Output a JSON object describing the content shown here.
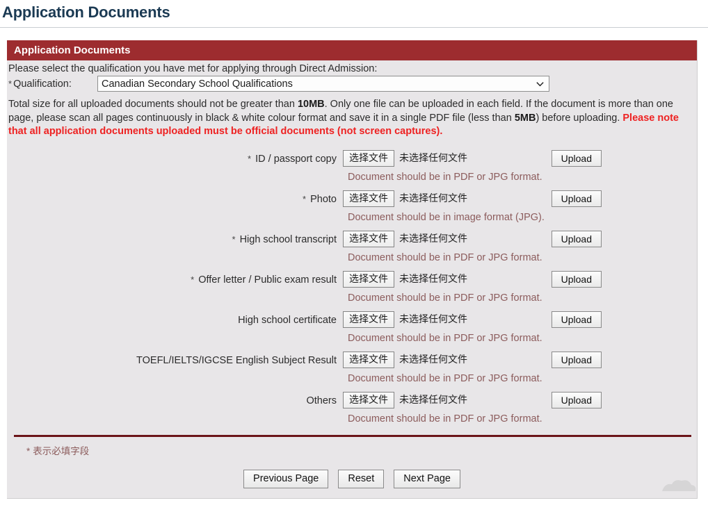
{
  "page": {
    "title": "Application Documents",
    "title_color": "#1b3a53",
    "background": "#ffffff",
    "panel_background": "#e8e6e8"
  },
  "panel": {
    "header_title": "Application Documents",
    "header_color": "#9d2c2f"
  },
  "qualification": {
    "intro": "Please select the qualification you have met for applying through Direct Admission:",
    "required_marker": "*",
    "label": "Qualification:",
    "selected_value": "Canadian Secondary School Qualifications",
    "dropdown_icon": "chevron-down-icon"
  },
  "notice": {
    "part1": "Total size for all uploaded documents should not be greater than ",
    "limit_total": "10MB",
    "part2": ". Only one file can be uploaded in each field. If the document is more than one page, please scan all pages continuously in black & white colour format and save it in a single PDF file (less than ",
    "limit_single": "5MB",
    "part3": ") before uploading. ",
    "warning": "Please note that all application documents uploaded must be official documents (not screen captures).",
    "warning_color": "#ee2222"
  },
  "file_input": {
    "choose_button_label": "选择文件",
    "no_file_text": "未选择任何文件",
    "upload_button_label": "Upload"
  },
  "hints": {
    "pdf_jpg": "Document should be in PDF or JPG format.",
    "image_jpg": "Document should be in image format (JPG).",
    "color": "#8c5c5c"
  },
  "upload_rows": [
    {
      "label": "ID / passport copy",
      "required": true,
      "hint": "Document should be in PDF or JPG format."
    },
    {
      "label": "Photo",
      "required": true,
      "hint": "Document should be in image format (JPG)."
    },
    {
      "label": "High school transcript",
      "required": true,
      "hint": "Document should be in PDF or JPG format."
    },
    {
      "label": "Offer letter / Public exam result",
      "required": true,
      "hint": "Document should be in PDF or JPG format."
    },
    {
      "label": "High school certificate",
      "required": false,
      "hint": "Document should be in PDF or JPG format."
    },
    {
      "label": "TOEFL/IELTS/IGCSE English Subject Result",
      "required": false,
      "hint": "Document should be in PDF or JPG format."
    },
    {
      "label": "Others",
      "required": false,
      "hint": "Document should be in PDF or JPG format."
    }
  ],
  "footer": {
    "required_marker": "*",
    "note": "表示必填字段",
    "divider_color": "#6b1418",
    "buttons": [
      {
        "label": "Previous Page",
        "name": "previous-page-button"
      },
      {
        "label": "Reset",
        "name": "reset-button"
      },
      {
        "label": "Next Page",
        "name": "next-page-button"
      }
    ]
  }
}
